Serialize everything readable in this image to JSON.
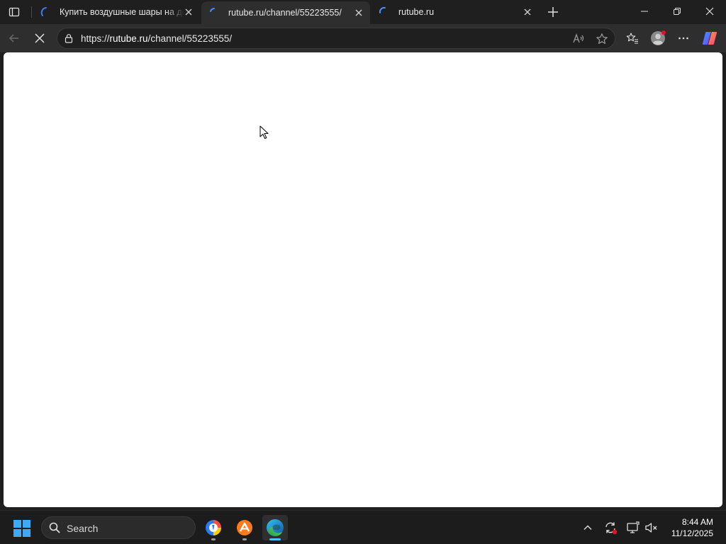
{
  "tabs": [
    {
      "title": "Купить воздушные шары на ден",
      "state": "loaded",
      "icon": "rutube-favicon-icon"
    },
    {
      "title": "rutube.ru/channel/55223555/",
      "state": "loading",
      "active": true,
      "icon": "loading-spinner-icon"
    },
    {
      "title": "rutube.ru",
      "state": "loading",
      "icon": "loading-spinner-icon"
    }
  ],
  "toolbar": {
    "url_prefix": "https://",
    "url_host": "rutube.ru",
    "url_path": "/channel/55223555/"
  },
  "taskbar": {
    "search_label": "Search",
    "time": "8:44 AM",
    "date": "11/12/2025"
  },
  "colors": {
    "accent": "#4cc2ff",
    "tab_active": "#2e2e2e",
    "frame": "#1f1f1f",
    "page_bg": "#ffffff",
    "notification_red": "#e81123"
  }
}
